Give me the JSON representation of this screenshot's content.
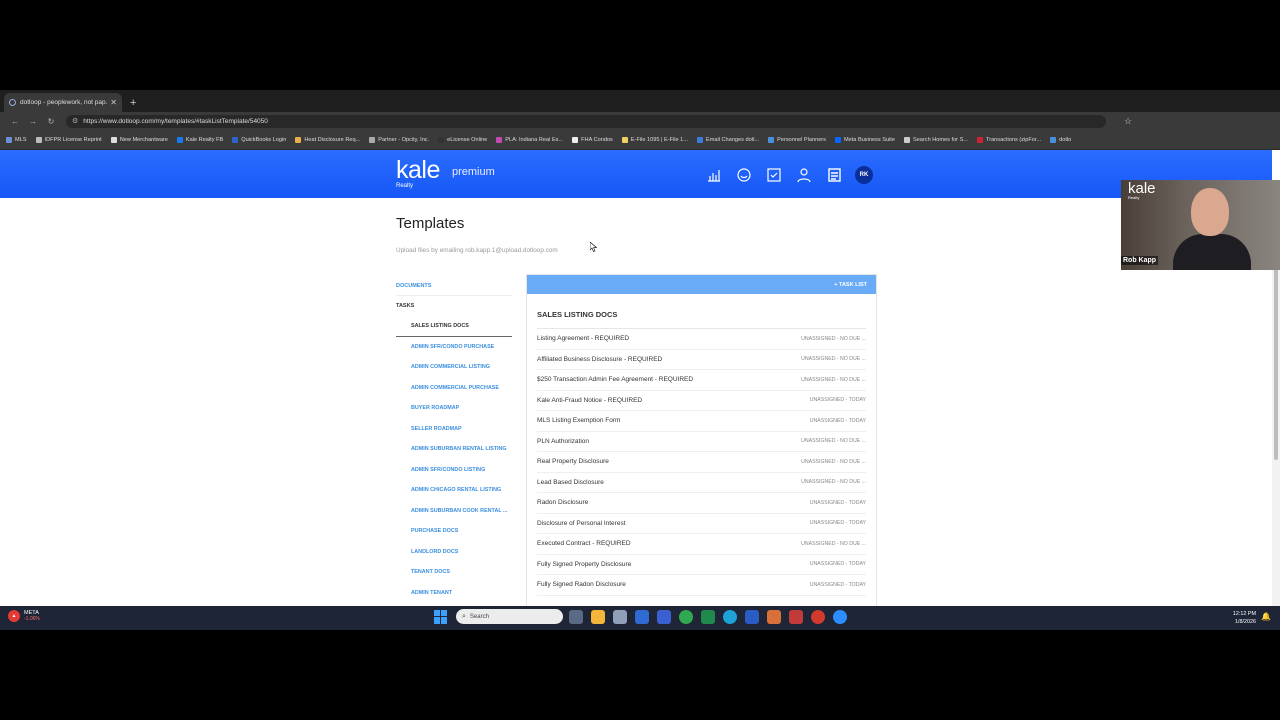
{
  "browser": {
    "tab_title": "dotloop - peoplework, not pap...",
    "url": "https://www.dotloop.com/my/templates/#taskListTemplate/54050",
    "bookmarks": [
      "MLS",
      "IDFPR License Reprint",
      "New Merchantware",
      "Kale Realty FB",
      "QuickBooks Login",
      "Heat Disclosure Req...",
      "Partner - Opcity, Inc.",
      "eLicense Online",
      "PLA: Indiana Real Es...",
      "FHA Condos",
      "E-File 1095 | E-File 1...",
      "Email Changes dotl...",
      "Personnel Planners",
      "Meta Business Suite",
      "Search Homes for S...",
      "Transactions (zipFor...",
      "dotlo"
    ]
  },
  "header": {
    "brand": "kale",
    "brand_sub": "Realty",
    "plan": "premium",
    "avatar_initials": "RK"
  },
  "page": {
    "title": "Templates",
    "upload_note": "Upload files by emailing rob.kapp.1@upload.dotloop.com"
  },
  "nav": {
    "documents": "DOCUMENTS",
    "tasks": "TASKS",
    "items": [
      "SALES LISTING DOCS",
      "ADMIN SFR/CONDO PURCHASE",
      "ADMIN COMMERCIAL LISTING",
      "ADMIN COMMERCIAL PURCHASE",
      "BUYER ROADMAP",
      "SELLER ROADMAP",
      "ADMIN SUBURBAN RENTAL LISTING",
      "ADMIN SFR/CONDO LISTING",
      "ADMIN CHICAGO RENTAL LISTING",
      "ADMIN SUBURBAN COOK RENTAL ...",
      "PURCHASE DOCS",
      "LANDLORD DOCS",
      "TENANT DOCS",
      "ADMIN TENANT"
    ]
  },
  "panel": {
    "button": "+ TASK LIST",
    "title": "SALES LISTING DOCS",
    "tasks": [
      {
        "name": "Listing Agreement - REQUIRED",
        "status": "UNASSIGNED - NO DUE ..."
      },
      {
        "name": "Affiliated Business Disclosure - REQUIRED",
        "status": "UNASSIGNED - NO DUE ..."
      },
      {
        "name": "$250 Transaction Admin Fee Agreement - REQUIRED",
        "status": "UNASSIGNED - NO DUE ..."
      },
      {
        "name": "Kale Anti-Fraud Notice - REQUIRED",
        "status": "UNASSIGNED - TODAY"
      },
      {
        "name": "MLS Listing Exemption Form",
        "status": "UNASSIGNED - TODAY"
      },
      {
        "name": "PLN Authorization",
        "status": "UNASSIGNED - NO DUE ..."
      },
      {
        "name": "Real Property Disclosure",
        "status": "UNASSIGNED - NO DUE ..."
      },
      {
        "name": "Lead Based Disclosure",
        "status": "UNASSIGNED - NO DUE ..."
      },
      {
        "name": "Radon Disclosure",
        "status": "UNASSIGNED - TODAY"
      },
      {
        "name": "Disclosure of Personal Interest",
        "status": "UNASSIGNED - TODAY"
      },
      {
        "name": "Executed Contract - REQUIRED",
        "status": "UNASSIGNED - NO DUE ..."
      },
      {
        "name": "Fully Signed Property Disclosure",
        "status": "UNASSIGNED - TODAY"
      },
      {
        "name": "Fully Signed Radon Disclosure",
        "status": "UNASSIGNED - TODAY"
      }
    ]
  },
  "webcam": {
    "logo": "kale",
    "logo_sub": "Realty",
    "name": "Rob Kapp"
  },
  "taskbar": {
    "ticker": "META",
    "change": "-1.06%",
    "search": "Search",
    "time": "12:12 PM",
    "date": "1/8/2026"
  }
}
